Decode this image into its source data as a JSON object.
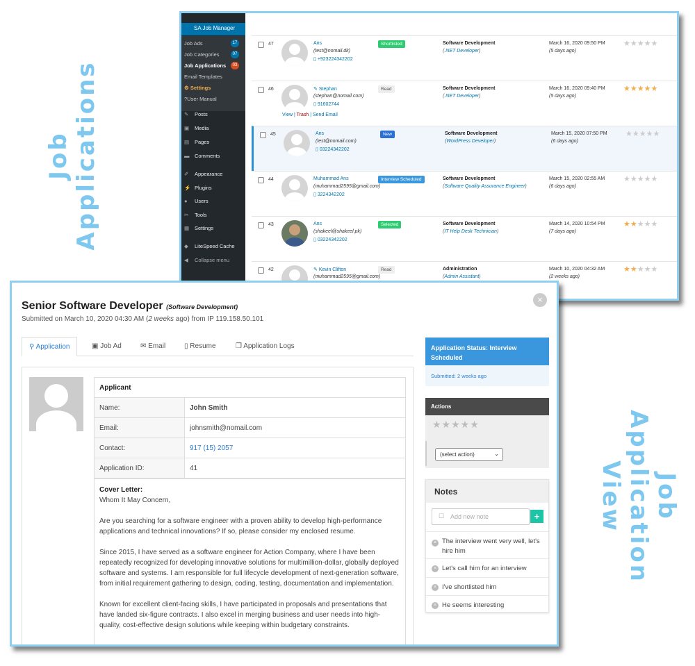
{
  "labels": {
    "job_applications": "Job Applications",
    "job_application_view": "Job Application View"
  },
  "colors": {
    "label": "#7ec8f0",
    "wp_sidebar": "#23282d",
    "wp_accent": "#0073aa",
    "status_blue": "#3a97dd",
    "note_add": "#1bc5a5"
  },
  "wp_menu": {
    "plugin": "SA Job Manager",
    "sub_items": [
      {
        "label": "Job Ads",
        "badge": "17"
      },
      {
        "label": "Job Categories",
        "badge": "07"
      },
      {
        "label": "Job Applications",
        "badge": "03"
      },
      {
        "label": "Email Templates",
        "badge": ""
      },
      {
        "label": "Settings",
        "badge": ""
      },
      {
        "label": "User Manual",
        "badge": ""
      }
    ],
    "items": [
      {
        "label": "Posts",
        "icon": "pushpin-icon"
      },
      {
        "label": "Media",
        "icon": "media-icon"
      },
      {
        "label": "Pages",
        "icon": "pages-icon"
      },
      {
        "label": "Comments",
        "icon": "comments-icon"
      },
      {
        "label": "Appearance",
        "icon": "brush-icon"
      },
      {
        "label": "Plugins",
        "icon": "plug-icon"
      },
      {
        "label": "Users",
        "icon": "user-icon"
      },
      {
        "label": "Tools",
        "icon": "wrench-icon"
      },
      {
        "label": "Settings",
        "icon": "settings-icon"
      },
      {
        "label": "LiteSpeed Cache",
        "icon": "diamond-icon"
      },
      {
        "label": "Collapse menu",
        "icon": "collapse-icon"
      }
    ]
  },
  "applications": [
    {
      "id": "47",
      "name": "Ans",
      "email": "(test@nomail.dk)",
      "phone": "+923224342202",
      "status": "Shortlisted",
      "category": "Software Development",
      "job": ".NET Developer",
      "date": "March 16, 2020 09:50 PM",
      "ago": "(5 days ago)",
      "rating": 0
    },
    {
      "id": "46",
      "name": "Stephan",
      "email": "(stephan@nomail.com)",
      "phone": "91602744",
      "status": "Read",
      "category": "Software Development",
      "job": ".NET Developer",
      "date": "March 16, 2020 09:40 PM",
      "ago": "(5 days ago)",
      "rating": 5,
      "row_actions": [
        "View",
        "Trash",
        "Send Email"
      ]
    },
    {
      "id": "45",
      "name": "Ans",
      "email": "(test@nomail.com)",
      "phone": "03224342202",
      "status": "New",
      "category": "Software Development",
      "job": "WordPress Developer",
      "date": "March 15, 2020 07:50 PM",
      "ago": "(6 days ago)",
      "rating": 0
    },
    {
      "id": "44",
      "name": "Muhammad Ans",
      "email": "(muhammad2595@gmail.com)",
      "phone": "3224342202",
      "status": "Interview Scheduled",
      "category": "Software Development",
      "job": "Software Quality Assurance Engineer",
      "date": "March 15, 2020 02:55 AM",
      "ago": "(6 days ago)",
      "rating": 0
    },
    {
      "id": "43",
      "name": "Ans",
      "email": "(shakeel@shakeel.pk)",
      "phone": "03224342202",
      "status": "Selected",
      "category": "Software Development",
      "job": "IT Help Desk Technician",
      "date": "March 14, 2020 10:54 PM",
      "ago": "(7 days ago)",
      "rating": 2
    },
    {
      "id": "42",
      "name": "Kevin Clifton",
      "email": "(muhammad2595@gmail.com)",
      "phone": "",
      "status": "Read",
      "category": "Administration",
      "job": "Admin Assistant",
      "date": "March 10, 2020 04:32 AM",
      "ago": "(2 weeks ago)",
      "rating": 2
    }
  ],
  "modal": {
    "title": "Senior Software Developer",
    "category": "(Software Development)",
    "submitted_prefix": "Submitted on March 10, 2020 04:30 AM (",
    "submitted_ago": "2 weeks",
    "submitted_suffix": " ago) from IP 119.158.50.101",
    "close": "×",
    "tabs": [
      "Application",
      "Job Ad",
      "Email",
      "Resume",
      "Application Logs"
    ],
    "applicant_heading": "Applicant",
    "fields": [
      {
        "key": "Name:",
        "value": "John Smith"
      },
      {
        "key": "Email:",
        "value": "johnsmith@nomail.com"
      },
      {
        "key": "Contact:",
        "value": "917 (15) 2057"
      },
      {
        "key": "Application ID:",
        "value": "41"
      }
    ],
    "cover_letter_label": "Cover Letter:",
    "cover_letter": [
      "Whom It May Concern,",
      "Are you searching for a software engineer with a proven ability to develop high-performance applications and technical innovations? If so, please consider my enclosed resume.",
      "Since 2015, I have served as a software engineer for Action Company, where I have been repeatedly recognized for developing innovative solutions for multimillion-dollar, globally deployed software and systems. I am responsible for full lifecycle development of next-generation software, from initial requirement gathering to design, coding, testing, documentation and implementation.",
      "Known for excellent client-facing skills, I have participated in proposals and presentations that have landed six-figure contracts. I also excel in merging business and user needs into high-quality, cost-effective design solutions while keeping within budgetary constraints."
    ],
    "status_label": "Application Status: Interview Scheduled",
    "status_submitted_prefix": "Submitted: ",
    "status_submitted": "2 weeks ago",
    "actions_heading": "Actions",
    "action_select": "(select action)",
    "notes_heading": "Notes",
    "note_placeholder": "Add new note",
    "note_add": "+",
    "notes": [
      "The interview went very well, let's hire him",
      "Let's call him for an interview",
      "I've shortlisted him",
      "He seems interesting"
    ]
  }
}
